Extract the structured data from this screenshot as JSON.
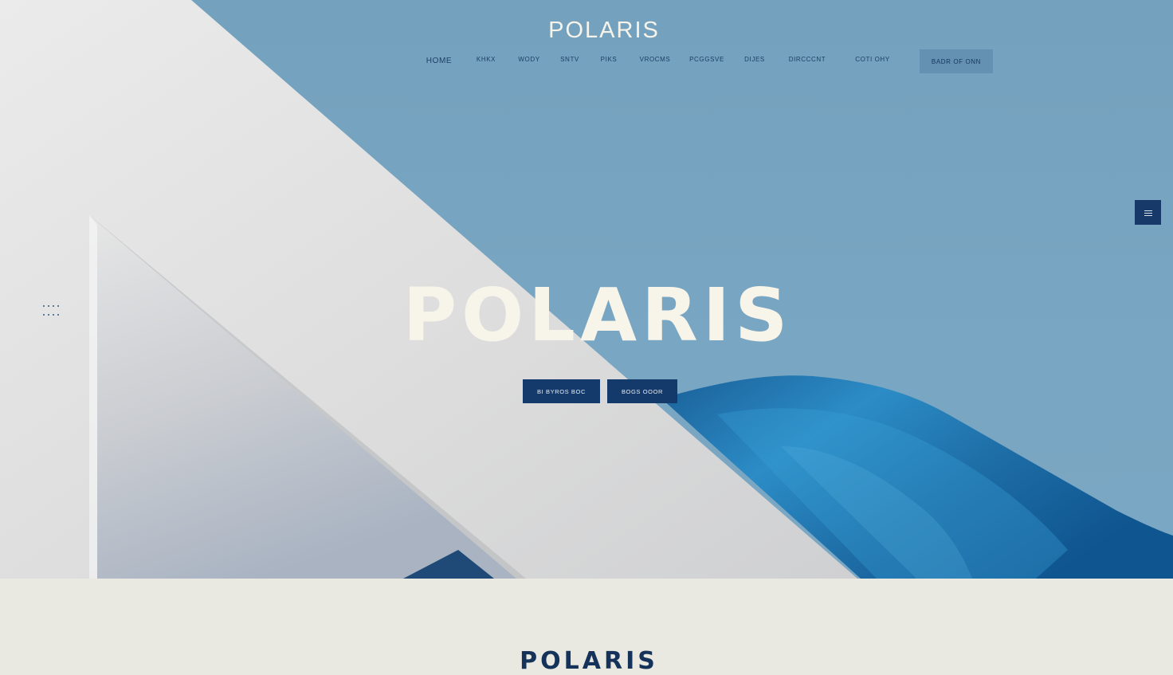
{
  "brand": {
    "logo": "POLARIS",
    "hero_title": "POLARIS",
    "section_title": "POLARIS"
  },
  "nav": {
    "items": [
      {
        "label": "HOME"
      },
      {
        "label": "KHKX"
      },
      {
        "label": "WODY"
      },
      {
        "label": "SNTV"
      },
      {
        "label": "PIKS"
      },
      {
        "label": "VROCMS"
      },
      {
        "label": "PCGGSVE"
      },
      {
        "label": "DIJES"
      },
      {
        "label": "DIRCCCNT"
      },
      {
        "label": "COTI OHY"
      }
    ],
    "book_label": "BADR OF ONN"
  },
  "hero": {
    "cta_primary": "BI BYROS BOC",
    "cta_secondary": "BOGS OOOR"
  },
  "icons": {
    "side_menu": "hamburger-menu-icon",
    "dots": "dots-grid-icon"
  },
  "colors": {
    "sky": "#74a1bd",
    "navy": "#133a6a",
    "cream": "#e9e8e1",
    "ocean": "#1e6ea7"
  }
}
